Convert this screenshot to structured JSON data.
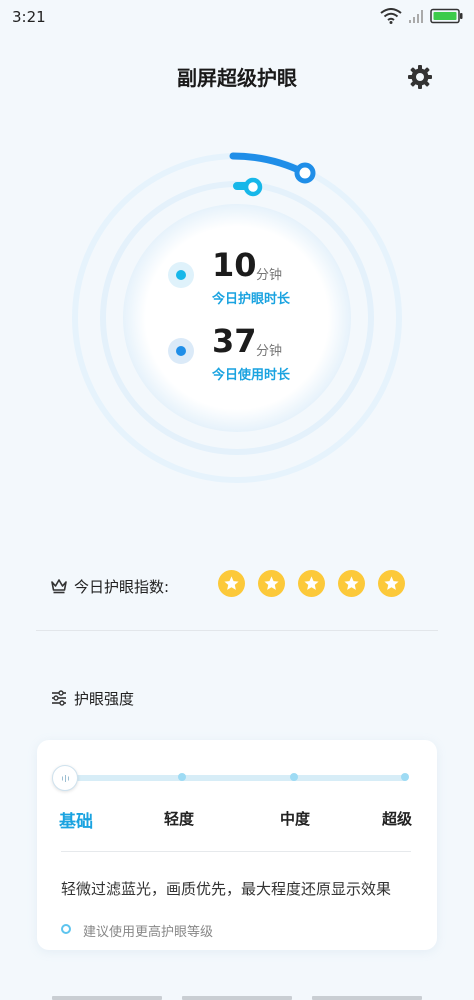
{
  "status_bar": {
    "time": "3:21",
    "icons": [
      "wifi-icon",
      "signal-icon",
      "battery-icon"
    ]
  },
  "header": {
    "title": "副屏超级护眼",
    "settings_icon": "gear-icon"
  },
  "stats": [
    {
      "value": "10",
      "unit": "分钟",
      "label": "今日护眼时长",
      "color": "#17b7e9"
    },
    {
      "value": "37",
      "unit": "分钟",
      "label": "今日使用时长",
      "color": "#1f8ee8"
    }
  ],
  "eye_index": {
    "label": "今日护眼指数:",
    "icon": "crown-icon",
    "stars": 5,
    "star_color": "#fcc93a"
  },
  "strength": {
    "title": "护眼强度",
    "icon": "sliders-icon",
    "levels": [
      "基础",
      "轻度",
      "中度",
      "超级"
    ],
    "selected": "基础",
    "description": "轻微过滤蓝光，画质优先，最大程度还原显示效果",
    "hint": "建议使用更高护眼等级"
  },
  "colors": {
    "accent": "#1aa3e0",
    "background": "#f3f8fc"
  }
}
